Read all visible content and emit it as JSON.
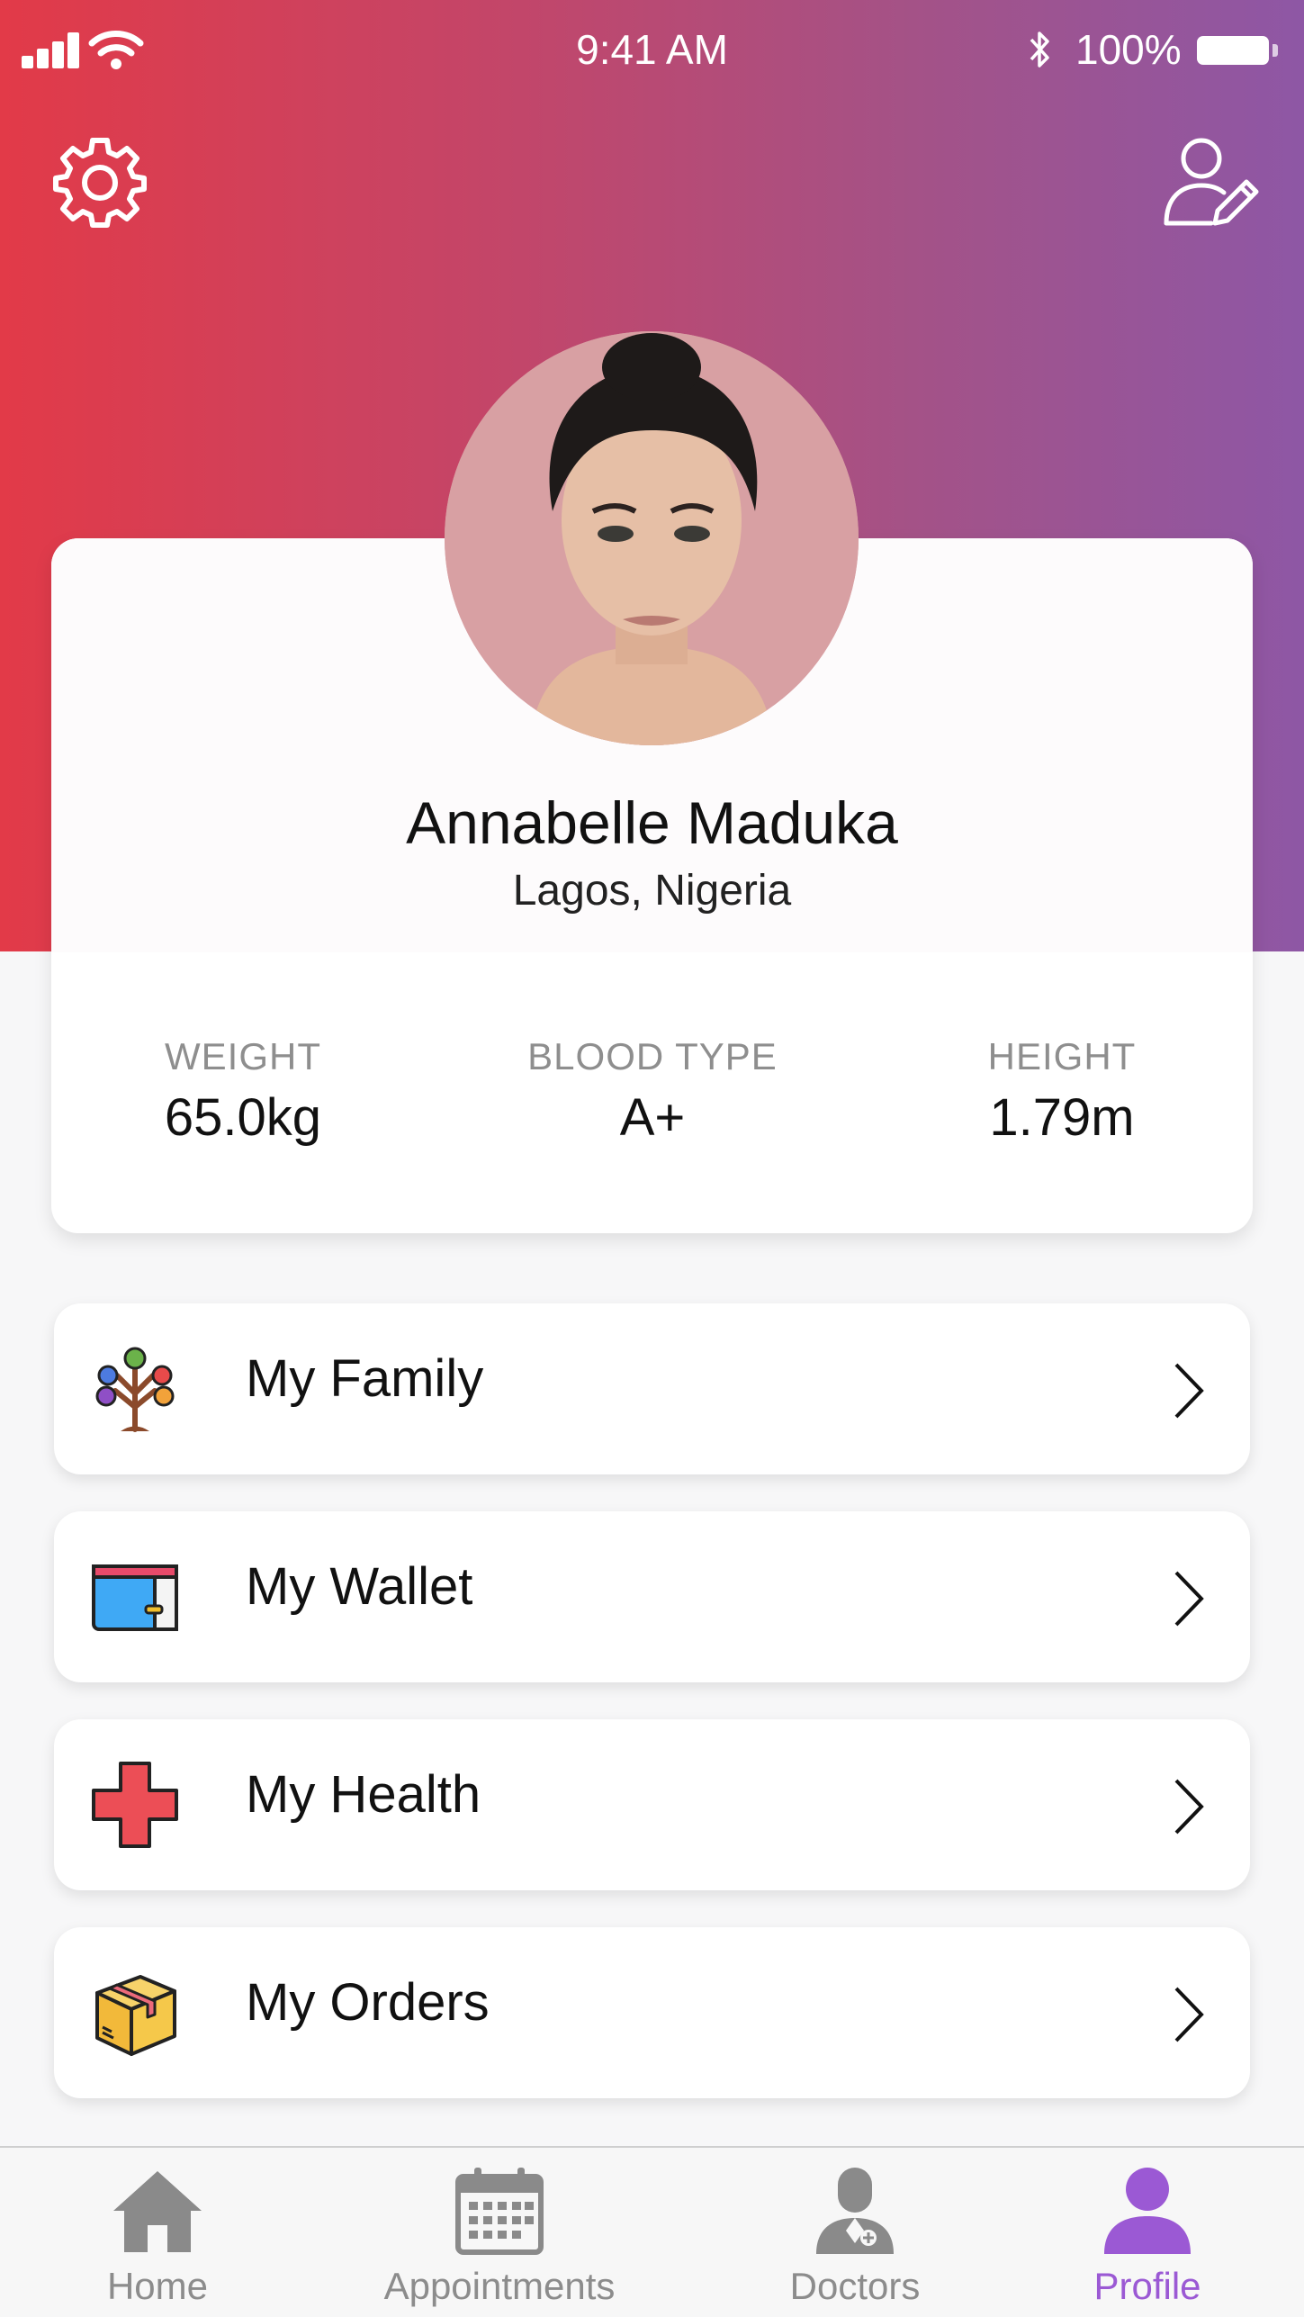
{
  "status_bar": {
    "time": "9:41 AM",
    "battery_percent": "100%",
    "battery_level": 1.0
  },
  "header": {
    "settings_icon": "gear-icon",
    "edit_profile_icon": "user-edit-icon"
  },
  "profile": {
    "name": "Annabelle Maduka",
    "location": "Lagos, Nigeria",
    "stats": [
      {
        "label": "WEIGHT",
        "value": "65.0kg"
      },
      {
        "label": "BLOOD TYPE",
        "value": "A+"
      },
      {
        "label": "HEIGHT",
        "value": "1.79m"
      }
    ]
  },
  "menu": [
    {
      "label": "My Family",
      "icon": "family-tree-icon"
    },
    {
      "label": "My Wallet",
      "icon": "wallet-icon"
    },
    {
      "label": "My Health",
      "icon": "medical-cross-icon"
    },
    {
      "label": "My Orders",
      "icon": "package-box-icon"
    }
  ],
  "tabs": [
    {
      "label": "Home",
      "icon": "home-icon",
      "active": false
    },
    {
      "label": "Appointments",
      "icon": "calendar-icon",
      "active": false
    },
    {
      "label": "Doctors",
      "icon": "doctor-icon",
      "active": false
    },
    {
      "label": "Profile",
      "icon": "person-icon",
      "active": true
    }
  ],
  "colors": {
    "gradient_start": "#e23a48",
    "gradient_end": "#8e57a5",
    "active_tab": "#9b59d4",
    "inactive_tab": "#8c8c8c"
  }
}
